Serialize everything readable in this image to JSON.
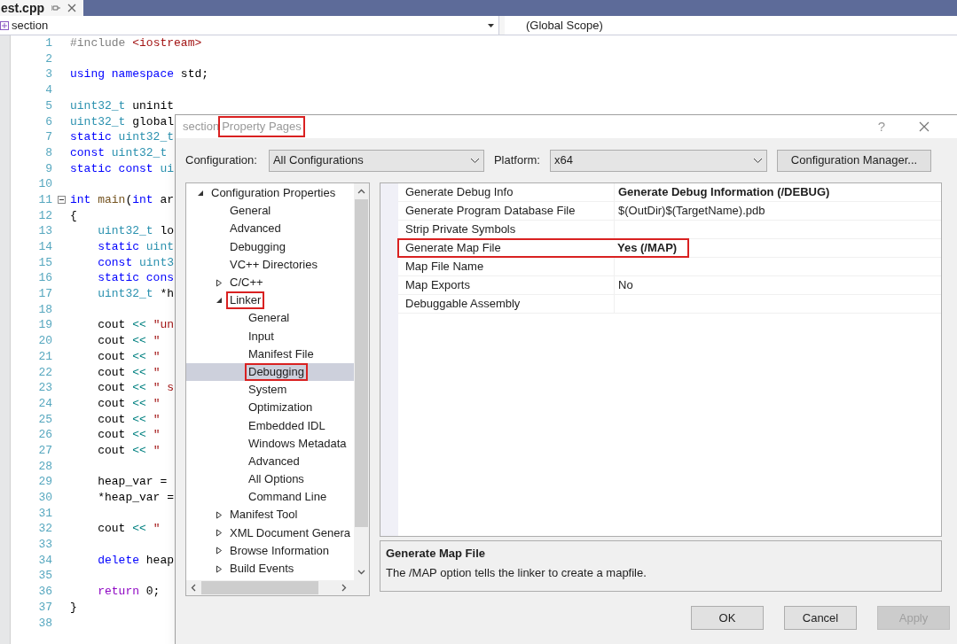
{
  "editor": {
    "tab": {
      "title": "est.cpp"
    },
    "nav": {
      "project": "section",
      "scope": "(Global Scope)"
    },
    "lines": [
      {
        "number": "1",
        "fold": false,
        "tokens": [
          {
            "text": "#include",
            "kind": "preproc"
          },
          {
            "text": " <iostream>",
            "kind": "string"
          }
        ]
      },
      {
        "number": "2",
        "fold": false
      },
      {
        "number": "3",
        "fold": false,
        "tokens": [
          {
            "text": "using",
            "kind": "keyword"
          },
          {
            "text": " namespace",
            "kind": "keyword"
          },
          {
            "text": " std;",
            "kind": "plain"
          }
        ]
      },
      {
        "number": "4",
        "fold": false
      },
      {
        "number": "5",
        "fold": false,
        "tokens": [
          {
            "text": "uint32_t",
            "kind": "type"
          },
          {
            "text": " uninit",
            "kind": "plain"
          }
        ]
      },
      {
        "number": "6",
        "fold": false,
        "tokens": [
          {
            "text": "uint32_t",
            "kind": "type"
          },
          {
            "text": " global",
            "kind": "plain"
          }
        ]
      },
      {
        "number": "7",
        "fold": false,
        "tokens": [
          {
            "text": "static",
            "kind": "keyword"
          },
          {
            "text": " uint32_t",
            "kind": "type"
          }
        ]
      },
      {
        "number": "8",
        "fold": false,
        "tokens": [
          {
            "text": "const",
            "kind": "keyword"
          },
          {
            "text": " uint32_t",
            "kind": "type"
          }
        ]
      },
      {
        "number": "9",
        "fold": false,
        "tokens": [
          {
            "text": "static",
            "kind": "keyword"
          },
          {
            "text": " const",
            "kind": "keyword"
          },
          {
            "text": " ui",
            "kind": "type"
          }
        ]
      },
      {
        "number": "10",
        "fold": false
      },
      {
        "number": "11",
        "fold": true,
        "tokens": [
          {
            "text": "int",
            "kind": "keyword"
          },
          {
            "text": " main",
            "kind": "function"
          },
          {
            "text": "(",
            "kind": "plain"
          },
          {
            "text": "int",
            "kind": "keyword"
          },
          {
            "text": " ar",
            "kind": "plain"
          }
        ]
      },
      {
        "number": "12",
        "fold": false,
        "tokens": [
          {
            "text": "{",
            "kind": "plain"
          }
        ]
      },
      {
        "number": "13",
        "fold": false,
        "tokens": [
          {
            "text": "    uint32_t",
            "kind": "type"
          },
          {
            "text": " lo",
            "kind": "plain"
          }
        ]
      },
      {
        "number": "14",
        "fold": false,
        "tokens": [
          {
            "text": "    static",
            "kind": "keyword"
          },
          {
            "text": " uint",
            "kind": "type"
          }
        ]
      },
      {
        "number": "15",
        "fold": false,
        "tokens": [
          {
            "text": "    const",
            "kind": "keyword"
          },
          {
            "text": " uint3",
            "kind": "type"
          }
        ]
      },
      {
        "number": "16",
        "fold": false,
        "tokens": [
          {
            "text": "    static",
            "kind": "keyword"
          },
          {
            "text": " cons",
            "kind": "keyword"
          }
        ]
      },
      {
        "number": "17",
        "fold": false,
        "tokens": [
          {
            "text": "    uint32_t",
            "kind": "type"
          },
          {
            "text": " *h",
            "kind": "plain"
          }
        ]
      },
      {
        "number": "18",
        "fold": false
      },
      {
        "number": "19",
        "fold": false,
        "tokens": [
          {
            "text": "    cout",
            "kind": "plain"
          },
          {
            "text": " <<",
            "kind": "operator"
          },
          {
            "text": " \"un",
            "kind": "string"
          }
        ]
      },
      {
        "number": "20",
        "fold": false,
        "tokens": [
          {
            "text": "    cout",
            "kind": "plain"
          },
          {
            "text": " <<",
            "kind": "operator"
          },
          {
            "text": " \"",
            "kind": "string"
          }
        ]
      },
      {
        "number": "21",
        "fold": false,
        "tokens": [
          {
            "text": "    cout",
            "kind": "plain"
          },
          {
            "text": " <<",
            "kind": "operator"
          },
          {
            "text": " \"",
            "kind": "string"
          }
        ]
      },
      {
        "number": "22",
        "fold": false,
        "tokens": [
          {
            "text": "    cout",
            "kind": "plain"
          },
          {
            "text": " <<",
            "kind": "operator"
          },
          {
            "text": " \"",
            "kind": "string"
          }
        ]
      },
      {
        "number": "23",
        "fold": false,
        "tokens": [
          {
            "text": "    cout",
            "kind": "plain"
          },
          {
            "text": " <<",
            "kind": "operator"
          },
          {
            "text": " \" s",
            "kind": "string"
          }
        ]
      },
      {
        "number": "24",
        "fold": false,
        "tokens": [
          {
            "text": "    cout",
            "kind": "plain"
          },
          {
            "text": " <<",
            "kind": "operator"
          },
          {
            "text": " \"",
            "kind": "string"
          }
        ]
      },
      {
        "number": "25",
        "fold": false,
        "tokens": [
          {
            "text": "    cout",
            "kind": "plain"
          },
          {
            "text": " <<",
            "kind": "operator"
          },
          {
            "text": " \"",
            "kind": "string"
          }
        ]
      },
      {
        "number": "26",
        "fold": false,
        "tokens": [
          {
            "text": "    cout",
            "kind": "plain"
          },
          {
            "text": " <<",
            "kind": "operator"
          },
          {
            "text": " \"",
            "kind": "string"
          }
        ]
      },
      {
        "number": "27",
        "fold": false,
        "tokens": [
          {
            "text": "    cout",
            "kind": "plain"
          },
          {
            "text": " <<",
            "kind": "operator"
          },
          {
            "text": " \"",
            "kind": "string"
          }
        ]
      },
      {
        "number": "28",
        "fold": false
      },
      {
        "number": "29",
        "fold": false,
        "tokens": [
          {
            "text": "    heap_var =",
            "kind": "plain"
          }
        ]
      },
      {
        "number": "30",
        "fold": false,
        "tokens": [
          {
            "text": "    *heap_var =",
            "kind": "plain"
          }
        ]
      },
      {
        "number": "31",
        "fold": false
      },
      {
        "number": "32",
        "fold": false,
        "tokens": [
          {
            "text": "    cout",
            "kind": "plain"
          },
          {
            "text": " <<",
            "kind": "operator"
          },
          {
            "text": " \"",
            "kind": "string"
          }
        ]
      },
      {
        "number": "33",
        "fold": false
      },
      {
        "number": "34",
        "fold": false,
        "tokens": [
          {
            "text": "    delete",
            "kind": "keyword"
          },
          {
            "text": " heap",
            "kind": "plain"
          }
        ]
      },
      {
        "number": "35",
        "fold": false
      },
      {
        "number": "36",
        "fold": false,
        "tokens": [
          {
            "text": "    return",
            "kind": "control"
          },
          {
            "text": " 0;",
            "kind": "plain"
          }
        ]
      },
      {
        "number": "37",
        "fold": false,
        "tokens": [
          {
            "text": "}",
            "kind": "plain"
          }
        ]
      },
      {
        "number": "38",
        "fold": false
      }
    ]
  },
  "dialog": {
    "title_prefix": "section",
    "title": "Property Pages",
    "title_highlighted": true,
    "help": "?",
    "configuration": {
      "label": "Configuration:",
      "value": "All Configurations"
    },
    "platform": {
      "label": "Platform:",
      "value": "x64"
    },
    "manager_button": "Configuration Manager...",
    "tree": [
      {
        "label": "Configuration Properties",
        "expanded": true,
        "selected": false,
        "highlighted": false,
        "children": [
          {
            "label": "General",
            "selected": false,
            "highlighted": false
          },
          {
            "label": "Advanced",
            "selected": false,
            "highlighted": false
          },
          {
            "label": "Debugging",
            "selected": false,
            "highlighted": false
          },
          {
            "label": "VC++ Directories",
            "selected": false,
            "highlighted": false
          },
          {
            "label": "C/C++",
            "expanded": false,
            "selected": false,
            "highlighted": false
          },
          {
            "label": "Linker",
            "expanded": true,
            "selected": false,
            "highlighted": true,
            "children": [
              {
                "label": "General",
                "selected": false,
                "highlighted": false
              },
              {
                "label": "Input",
                "selected": false,
                "highlighted": false
              },
              {
                "label": "Manifest File",
                "selected": false,
                "highlighted": false
              },
              {
                "label": "Debugging",
                "selected": true,
                "highlighted": true
              },
              {
                "label": "System",
                "selected": false,
                "highlighted": false
              },
              {
                "label": "Optimization",
                "selected": false,
                "highlighted": false
              },
              {
                "label": "Embedded IDL",
                "selected": false,
                "highlighted": false
              },
              {
                "label": "Windows Metadata",
                "selected": false,
                "highlighted": false
              },
              {
                "label": "Advanced",
                "selected": false,
                "highlighted": false
              },
              {
                "label": "All Options",
                "selected": false,
                "highlighted": false
              },
              {
                "label": "Command Line",
                "selected": false,
                "highlighted": false
              }
            ]
          },
          {
            "label": "Manifest Tool",
            "expanded": false,
            "selected": false,
            "highlighted": false
          },
          {
            "label": "XML Document Genera",
            "expanded": false,
            "selected": false,
            "highlighted": false
          },
          {
            "label": "Browse Information",
            "expanded": false,
            "selected": false,
            "highlighted": false
          },
          {
            "label": "Build Events",
            "expanded": false,
            "selected": false,
            "highlighted": false
          }
        ]
      }
    ],
    "properties": [
      {
        "name": "Generate Debug Info",
        "value": "Generate Debug Information (/DEBUG)",
        "modified": true,
        "highlighted": false
      },
      {
        "name": "Generate Program Database File",
        "value": "$(OutDir)$(TargetName).pdb",
        "modified": false,
        "highlighted": false
      },
      {
        "name": "Strip Private Symbols",
        "highlighted": false
      },
      {
        "name": "Generate Map File",
        "value": "Yes (/MAP)",
        "modified": true,
        "highlighted": true
      },
      {
        "name": "Map File Name",
        "highlighted": false
      },
      {
        "name": "Map Exports",
        "value": "No",
        "modified": false,
        "highlighted": false
      },
      {
        "name": "Debuggable Assembly",
        "highlighted": false
      }
    ],
    "description": {
      "title": "Generate Map File",
      "text": "The /MAP option tells the linker to create a mapfile."
    },
    "buttons": [
      {
        "label": "OK",
        "disabled": false
      },
      {
        "label": "Cancel",
        "disabled": false
      },
      {
        "label": "Apply",
        "disabled": true
      }
    ]
  }
}
